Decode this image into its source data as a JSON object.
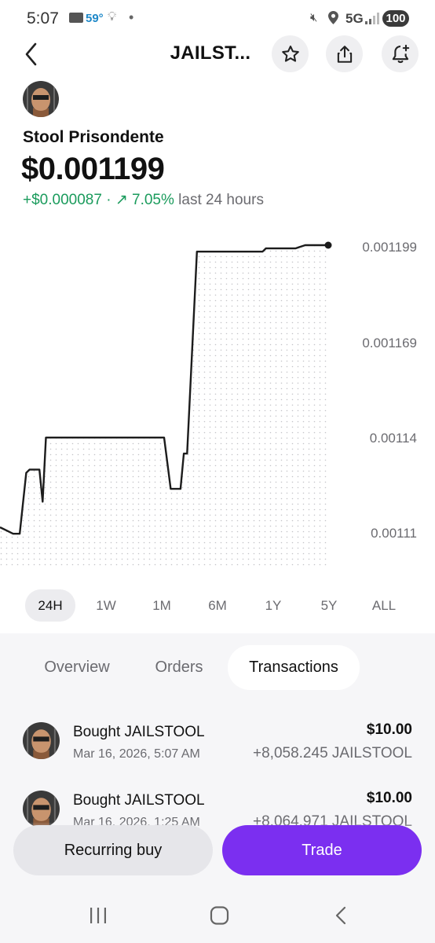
{
  "status_bar": {
    "time": "5:07",
    "temperature": "59°",
    "network": "5G",
    "battery": "100",
    "icons": [
      "mail-icon",
      "bulb-icon",
      "dot-icon",
      "mute-icon",
      "location-icon",
      "signal-icon"
    ]
  },
  "header": {
    "title": "JAILST...",
    "icons": [
      "back-chevron-icon",
      "star-icon",
      "share-icon",
      "bell-plus-icon"
    ]
  },
  "asset": {
    "name": "Stool Prisondente",
    "price": "$0.001199",
    "change_abs": "+$0.000087",
    "separator": " · ",
    "change_pct": "↗ 7.05%",
    "change_period": " last 24 hours"
  },
  "chart_data": {
    "type": "line",
    "y_tick_labels": [
      "0.001199",
      "0.001169",
      "0.00114",
      "0.00111"
    ],
    "ylim": [
      0.0011,
      0.0012
    ],
    "x": [
      0,
      2,
      4,
      6,
      8,
      9,
      10,
      12,
      13,
      14,
      16,
      18,
      20,
      30,
      40,
      50,
      52,
      55,
      56,
      57,
      60,
      80,
      81,
      90,
      93,
      100
    ],
    "values": [
      0.001112,
      0.001111,
      0.00111,
      0.00111,
      0.001129,
      0.00113,
      0.00113,
      0.00113,
      0.00112,
      0.00114,
      0.00114,
      0.00114,
      0.00114,
      0.00114,
      0.00114,
      0.00114,
      0.001124,
      0.001124,
      0.001135,
      0.001135,
      0.001198,
      0.001198,
      0.001199,
      0.001199,
      0.0012,
      0.0012
    ],
    "color": "#1c1c1c",
    "grid": false
  },
  "ranges": [
    "24H",
    "1W",
    "1M",
    "6M",
    "1Y",
    "5Y",
    "ALL"
  ],
  "active_range": "24H",
  "sub_tabs": [
    "Overview",
    "Orders",
    "Transactions"
  ],
  "active_sub_tab": "Transactions",
  "transactions": [
    {
      "title": "Bought JAILSTOOL",
      "date": "Mar 16, 2026, 5:07 AM",
      "amount": "$10.00",
      "quantity": "+8,058.245 JAILSTOOL"
    },
    {
      "title": "Bought JAILSTOOL",
      "date": "Mar 16, 2026, 1:25 AM",
      "amount": "$10.00",
      "quantity": "+8,064.971 JAILSTOOL"
    }
  ],
  "actions": {
    "recurring_label": "Recurring buy",
    "trade_label": "Trade"
  },
  "colors": {
    "positive": "#1a9b5c",
    "brand_purple": "#7b2ff0",
    "line": "#1c1c1c"
  },
  "nav_icons": [
    "recent-apps-icon",
    "home-icon",
    "back-icon"
  ]
}
